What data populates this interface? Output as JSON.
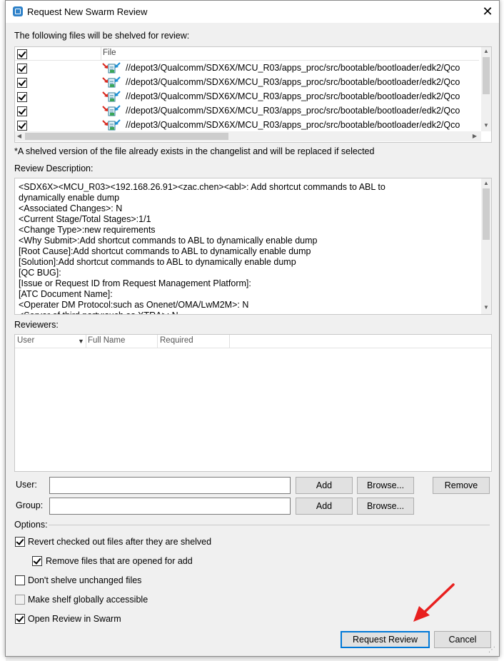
{
  "window": {
    "title": "Request New Swarm Review"
  },
  "files_section": {
    "heading": "The following files will be shelved for review:",
    "column_file": "File",
    "rows": [
      {
        "checked": true,
        "path": "//depot3/Qualcomm/SDX6X/MCU_R03/apps_proc/src/bootable/bootloader/edk2/Qco"
      },
      {
        "checked": true,
        "path": "//depot3/Qualcomm/SDX6X/MCU_R03/apps_proc/src/bootable/bootloader/edk2/Qco"
      },
      {
        "checked": true,
        "path": "//depot3/Qualcomm/SDX6X/MCU_R03/apps_proc/src/bootable/bootloader/edk2/Qco"
      },
      {
        "checked": true,
        "path": "//depot3/Qualcomm/SDX6X/MCU_R03/apps_proc/src/bootable/bootloader/edk2/Qco"
      },
      {
        "checked": true,
        "path": "//depot3/Qualcomm/SDX6X/MCU_R03/apps_proc/src/bootable/bootloader/edk2/Qco"
      }
    ],
    "note": "*A shelved version of the file already exists in the changelist and will be replaced if selected"
  },
  "description": {
    "label": "Review Description:",
    "lines": [
      "<SDX6X><MCU_R03><192.168.26.91><zac.chen><abl>: Add shortcut commands to ABL to",
      "dynamically enable dump",
      "<Associated Changes>: N",
      "<Current Stage/Total Stages>:1/1",
      "<Change Type>:new requirements",
      "<Why Submit>:Add shortcut commands to ABL to dynamically enable dump",
      "[Root Cause]:Add shortcut commands to ABL to dynamically enable dump",
      "[Solution]:Add shortcut commands to ABL to dynamically enable dump",
      "[QC BUG]:",
      "[Issue or Request ID from Request Management Platform]:",
      "[ATC Document Name]:",
      "<Operater DM Protocol:such as Onenet/OMA/LwM2M>: N",
      "<Server of third party:such as XTRA>: N"
    ]
  },
  "reviewers": {
    "label": "Reviewers:",
    "columns": [
      "User",
      "Full Name",
      "Required"
    ]
  },
  "form": {
    "user_label": "User:",
    "group_label": "Group:",
    "add_label": "Add",
    "browse_label": "Browse...",
    "remove_label": "Remove"
  },
  "options": {
    "label": "Options:",
    "revert": "Revert checked out files after they are shelved",
    "remove_open_for_add": "Remove files that are opened for add",
    "dont_shelve_unchanged": "Don't shelve unchanged files",
    "make_global": "Make shelf globally accessible",
    "open_in_swarm": "Open Review in Swarm"
  },
  "buttons": {
    "request_review": "Request Review",
    "cancel": "Cancel"
  },
  "colors": {
    "accent": "#0078d7",
    "annotation_arrow": "#e8201f"
  }
}
